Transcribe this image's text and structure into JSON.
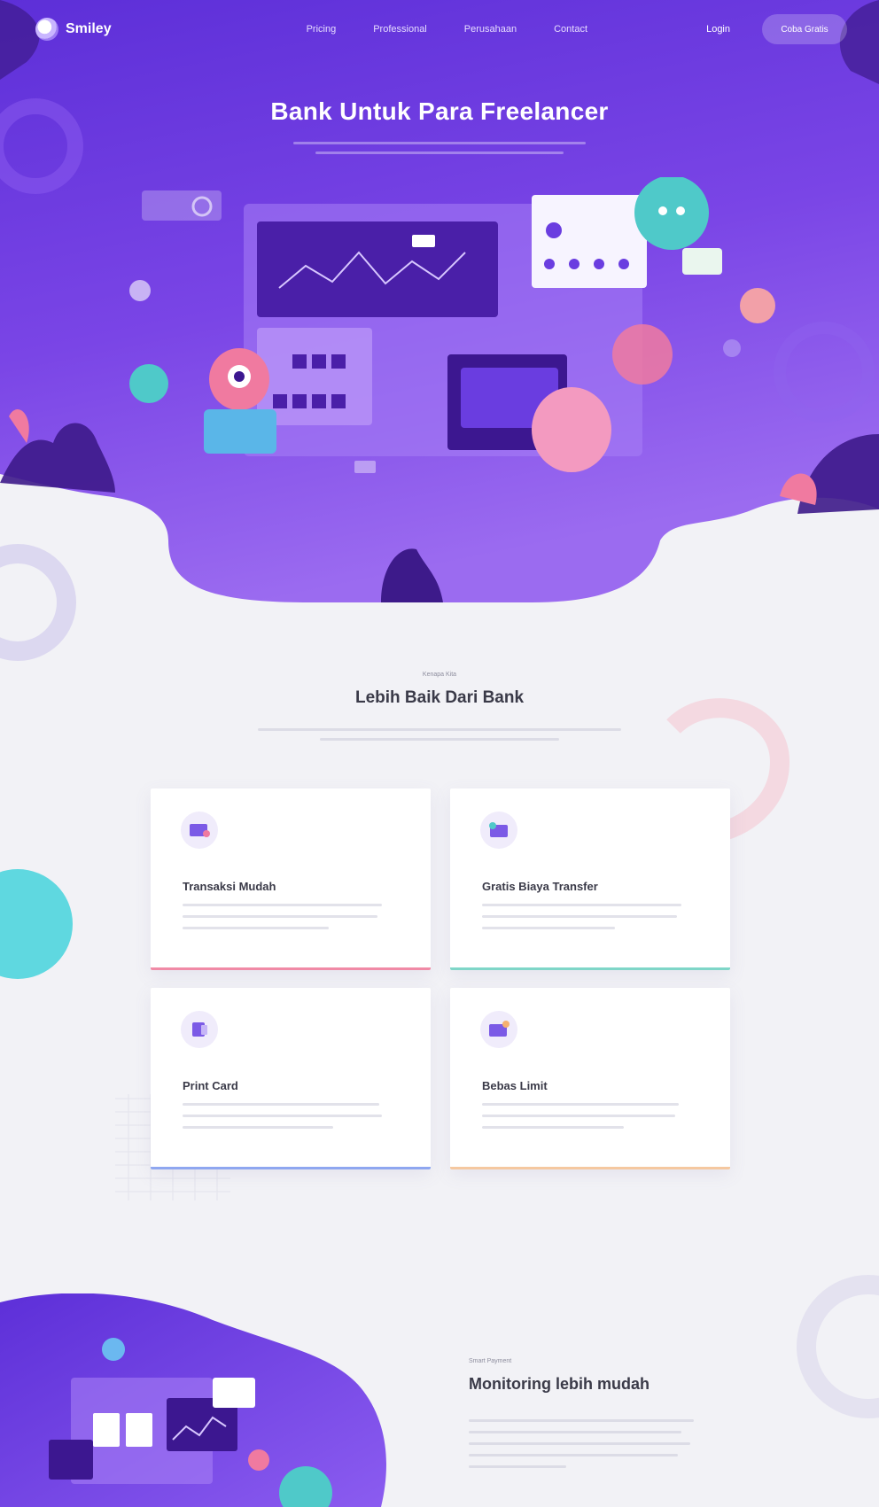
{
  "brand": {
    "name": "Smiley"
  },
  "nav": {
    "links": [
      "Pricing",
      "Professional",
      "Perusahaan",
      "Contact"
    ],
    "login": "Login",
    "cta": "Coba Gratis"
  },
  "hero": {
    "title": "Bank Untuk Para Freelancer"
  },
  "features": {
    "eyebrow": "Kenapa Kita",
    "title": "Lebih Baik Dari Bank",
    "cards": [
      {
        "title": "Transaksi Mudah",
        "icon": "wallet-icon",
        "accent": "#f08aa6"
      },
      {
        "title": "Gratis Biaya Transfer",
        "icon": "transfer-icon",
        "accent": "#7fd6c8"
      },
      {
        "title": "Print Card",
        "icon": "card-icon",
        "accent": "#8fa7f0"
      },
      {
        "title": "Bebas Limit",
        "icon": "limit-icon",
        "accent": "#f5c8a0"
      }
    ]
  },
  "monitoring": {
    "eyebrow": "Smart Payment",
    "title": "Monitoring lebih mudah"
  },
  "colors": {
    "primary": "#7b3fe4",
    "primary_dark": "#5a2bd0",
    "background": "#f2f2f6"
  }
}
